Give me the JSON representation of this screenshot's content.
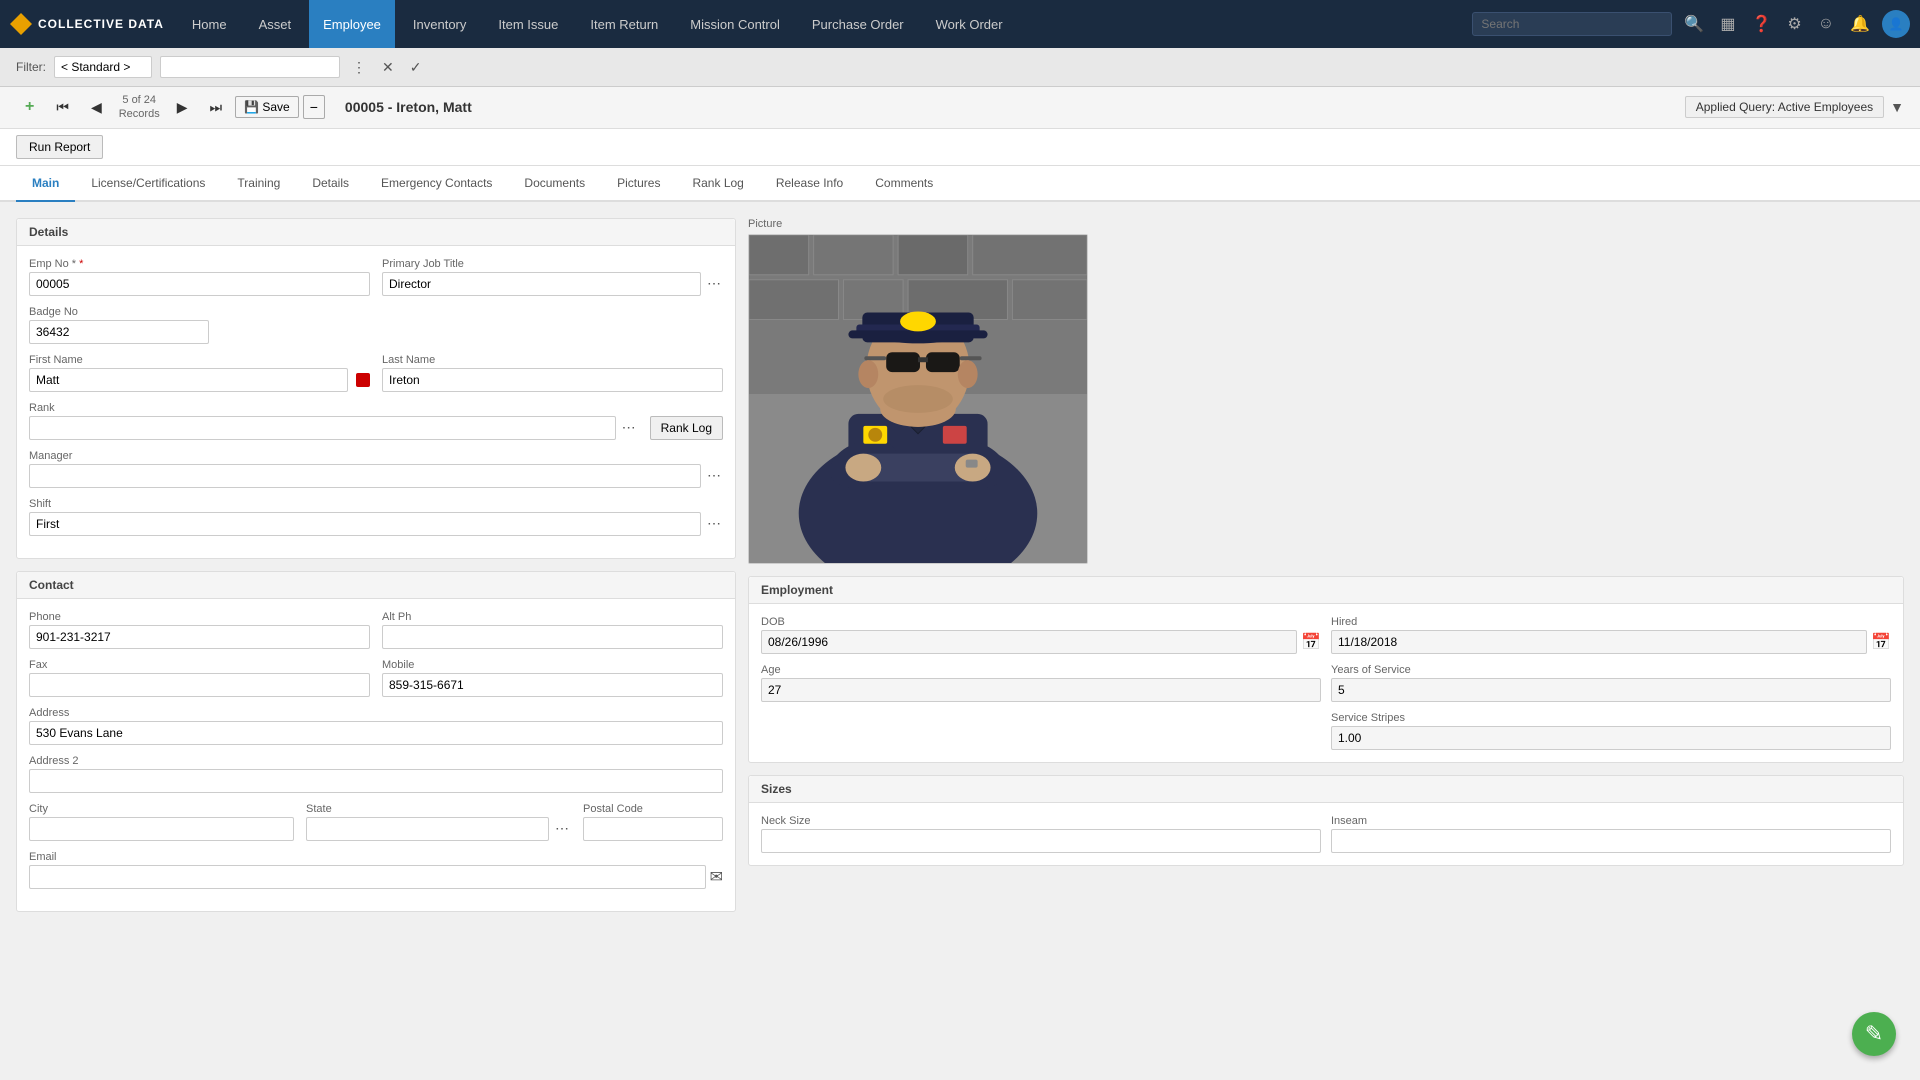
{
  "app": {
    "logo_text": "COLLECTIVE DATA",
    "search_placeholder": "Search"
  },
  "nav": {
    "items": [
      {
        "label": "Home",
        "active": false
      },
      {
        "label": "Asset",
        "active": false
      },
      {
        "label": "Employee",
        "active": true
      },
      {
        "label": "Inventory",
        "active": false
      },
      {
        "label": "Item Issue",
        "active": false
      },
      {
        "label": "Item Return",
        "active": false
      },
      {
        "label": "Mission Control",
        "active": false
      },
      {
        "label": "Purchase Order",
        "active": false
      },
      {
        "label": "Work Order",
        "active": false
      }
    ]
  },
  "filter": {
    "label": "Filter:",
    "selected": "< Standard >",
    "cancel_label": "✕",
    "confirm_label": "✓"
  },
  "toolbar": {
    "add_label": "+",
    "first_label": "⏮",
    "prev_label": "◀",
    "records": "5 of 24\nRecords",
    "next_label": "▶",
    "last_label": "⏭",
    "save_label": "💾 Save",
    "minus_label": "−",
    "record_title": "00005 - Ireton, Matt",
    "applied_query": "Applied Query: Active Employees"
  },
  "run_report": {
    "label": "Run Report"
  },
  "tabs": [
    {
      "label": "Main",
      "active": true
    },
    {
      "label": "License/Certifications",
      "active": false
    },
    {
      "label": "Training",
      "active": false
    },
    {
      "label": "Details",
      "active": false
    },
    {
      "label": "Emergency Contacts",
      "active": false
    },
    {
      "label": "Documents",
      "active": false
    },
    {
      "label": "Pictures",
      "active": false
    },
    {
      "label": "Rank Log",
      "active": false
    },
    {
      "label": "Release Info",
      "active": false
    },
    {
      "label": "Comments",
      "active": false
    }
  ],
  "details_section": {
    "title": "Details",
    "emp_no_label": "Emp No *",
    "emp_no_value": "00005",
    "primary_job_title_label": "Primary Job Title",
    "primary_job_title_value": "Director",
    "badge_no_label": "Badge No",
    "badge_no_value": "36432",
    "first_name_label": "First Name",
    "first_name_value": "Matt",
    "last_name_label": "Last Name",
    "last_name_value": "Ireton",
    "rank_label": "Rank",
    "rank_value": "",
    "rank_log_btn": "Rank Log",
    "manager_label": "Manager",
    "manager_value": "",
    "shift_label": "Shift",
    "shift_value": "First"
  },
  "contact_section": {
    "title": "Contact",
    "phone_label": "Phone",
    "phone_value": "901-231-3217",
    "alt_ph_label": "Alt Ph",
    "alt_ph_value": "",
    "fax_label": "Fax",
    "fax_value": "",
    "mobile_label": "Mobile",
    "mobile_value": "859-315-6671",
    "address_label": "Address",
    "address_value": "530 Evans Lane",
    "address2_label": "Address 2",
    "address2_value": "",
    "city_label": "City",
    "city_value": "",
    "state_label": "State",
    "state_value": "",
    "postal_code_label": "Postal Code",
    "postal_code_value": "",
    "email_label": "Email",
    "email_value": ""
  },
  "picture_section": {
    "label": "Picture"
  },
  "employment_section": {
    "title": "Employment",
    "dob_label": "DOB",
    "dob_value": "08/26/1996",
    "hired_label": "Hired",
    "hired_value": "11/18/2018",
    "age_label": "Age",
    "age_value": "27",
    "years_of_service_label": "Years of Service",
    "years_of_service_value": "5",
    "service_stripes_label": "Service Stripes",
    "service_stripes_value": "1.00"
  },
  "sizes_section": {
    "title": "Sizes",
    "neck_size_label": "Neck Size",
    "neck_size_value": "",
    "inseam_label": "Inseam",
    "inseam_value": ""
  },
  "fab": {
    "label": "✎"
  }
}
